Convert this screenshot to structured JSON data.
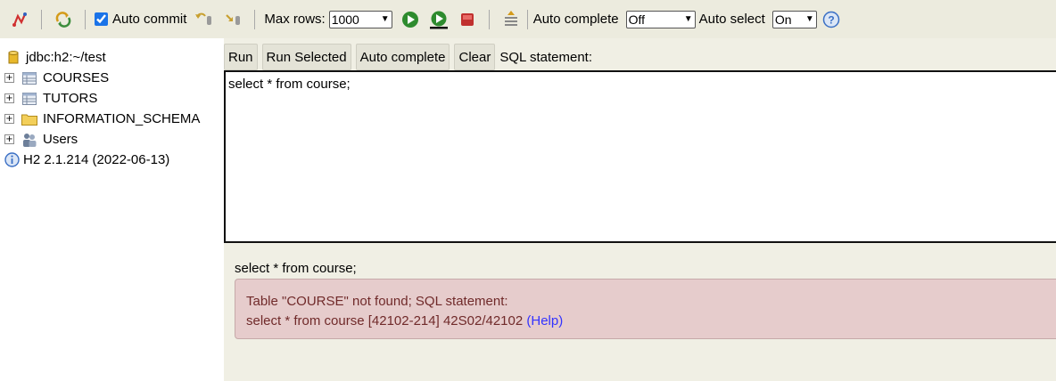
{
  "toolbar": {
    "auto_commit_label": "Auto commit",
    "auto_commit_checked": true,
    "max_rows_label": "Max rows:",
    "max_rows_value": "1000",
    "auto_complete_label": "Auto complete",
    "auto_complete_value": "Off",
    "auto_select_label": "Auto select",
    "auto_select_value": "On",
    "icons": [
      "disconnect-icon",
      "refresh-icon",
      "rollback-icon",
      "commit-icon",
      "run-icon",
      "run-selected-icon",
      "stop-icon",
      "history-icon",
      "help-icon"
    ]
  },
  "tree": {
    "connection": "jdbc:h2:~/test",
    "items": [
      {
        "label": "COURSES",
        "icon": "table-icon"
      },
      {
        "label": "TUTORS",
        "icon": "table-icon"
      },
      {
        "label": "INFORMATION_SCHEMA",
        "icon": "folder-icon"
      },
      {
        "label": "Users",
        "icon": "users-icon"
      }
    ],
    "version": "H2 2.1.214 (2022-06-13)"
  },
  "buttons": {
    "run": "Run",
    "run_selected": "Run Selected",
    "auto_complete": "Auto complete",
    "clear": "Clear"
  },
  "sql_label": "SQL statement:",
  "editor_text": "select * from course;",
  "result": {
    "statement_echo": "select * from course;",
    "error_line1": "Table \"COURSE\" not found; SQL statement:",
    "error_line2": "select * from course [42102-214] 42S02/42102",
    "help_link": "(Help)"
  },
  "colors": {
    "toolbar_bg": "#ecebde",
    "pane_bg": "#f0efe4",
    "error_bg": "#e6cccc",
    "error_text": "#702a2a",
    "link": "#3333ff"
  }
}
